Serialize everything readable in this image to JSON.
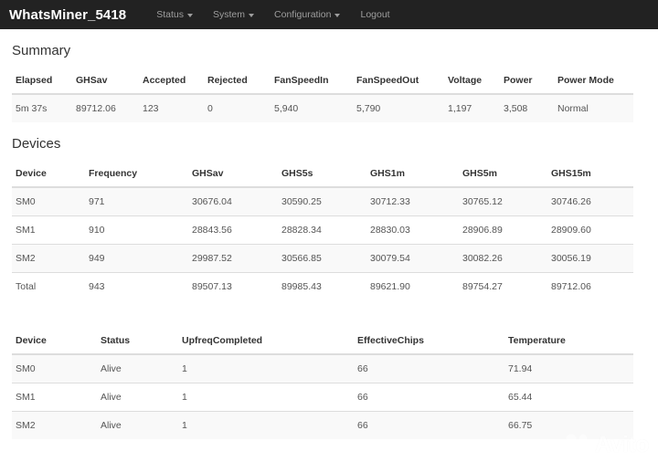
{
  "navbar": {
    "brand": "WhatsMiner_5418",
    "items": [
      {
        "label": "Status",
        "has_caret": true
      },
      {
        "label": "System",
        "has_caret": true
      },
      {
        "label": "Configuration",
        "has_caret": true
      },
      {
        "label": "Logout",
        "has_caret": false
      }
    ],
    "background": "#222222",
    "text_color": "#9d9d9d"
  },
  "summary": {
    "title": "Summary",
    "columns": [
      "Elapsed",
      "GHSav",
      "Accepted",
      "Rejected",
      "FanSpeedIn",
      "FanSpeedOut",
      "Voltage",
      "Power",
      "Power Mode"
    ],
    "rows": [
      [
        "5m 37s",
        "89712.06",
        "123",
        "0",
        "5,940",
        "5,790",
        "1,197",
        "3,508",
        "Normal"
      ]
    ]
  },
  "devices": {
    "title": "Devices",
    "table_a": {
      "columns": [
        "Device",
        "Frequency",
        "GHSav",
        "GHS5s",
        "GHS1m",
        "GHS5m",
        "GHS15m"
      ],
      "rows": [
        [
          "SM0",
          "971",
          "30676.04",
          "30590.25",
          "30712.33",
          "30765.12",
          "30746.26"
        ],
        [
          "SM1",
          "910",
          "28843.56",
          "28828.34",
          "28830.03",
          "28906.89",
          "28909.60"
        ],
        [
          "SM2",
          "949",
          "29987.52",
          "30566.85",
          "30079.54",
          "30082.26",
          "30056.19"
        ],
        [
          "Total",
          "943",
          "89507.13",
          "89985.43",
          "89621.90",
          "89754.27",
          "89712.06"
        ]
      ]
    },
    "table_b": {
      "columns": [
        "Device",
        "Status",
        "UpfreqCompleted",
        "EffectiveChips",
        "Temperature"
      ],
      "rows": [
        [
          "SM0",
          "Alive",
          "1",
          "66",
          "71.94"
        ],
        [
          "SM1",
          "Alive",
          "1",
          "66",
          "65.44"
        ],
        [
          "SM2",
          "Alive",
          "1",
          "66",
          "66.75"
        ]
      ]
    }
  },
  "watermark": {
    "text": "Avito",
    "color": "#ffffff"
  }
}
